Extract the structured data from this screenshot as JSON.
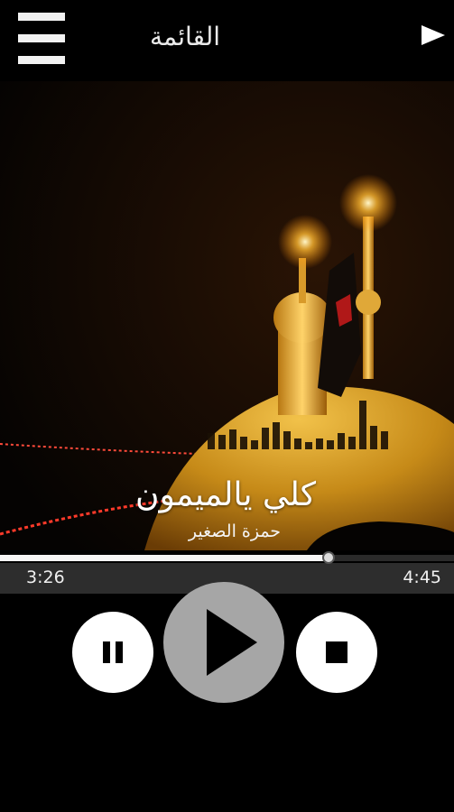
{
  "header": {
    "title": "القائمة",
    "menu_icon": "hamburger-menu-icon",
    "play_icon": "play-arrow-icon"
  },
  "track": {
    "title": "كلي يالميمون",
    "artist": "حمزة الصغير",
    "current_time": "3:26",
    "total_time": "4:45",
    "progress_fraction": 0.723
  },
  "controls": {
    "pause_icon": "pause-icon",
    "play_icon": "play-icon",
    "stop_icon": "stop-icon"
  },
  "colors": {
    "background": "#000000",
    "progress_fill": "#f5f5f5",
    "timebar_bg": "#2d2d2d",
    "play_button": "#a6a6a6"
  }
}
